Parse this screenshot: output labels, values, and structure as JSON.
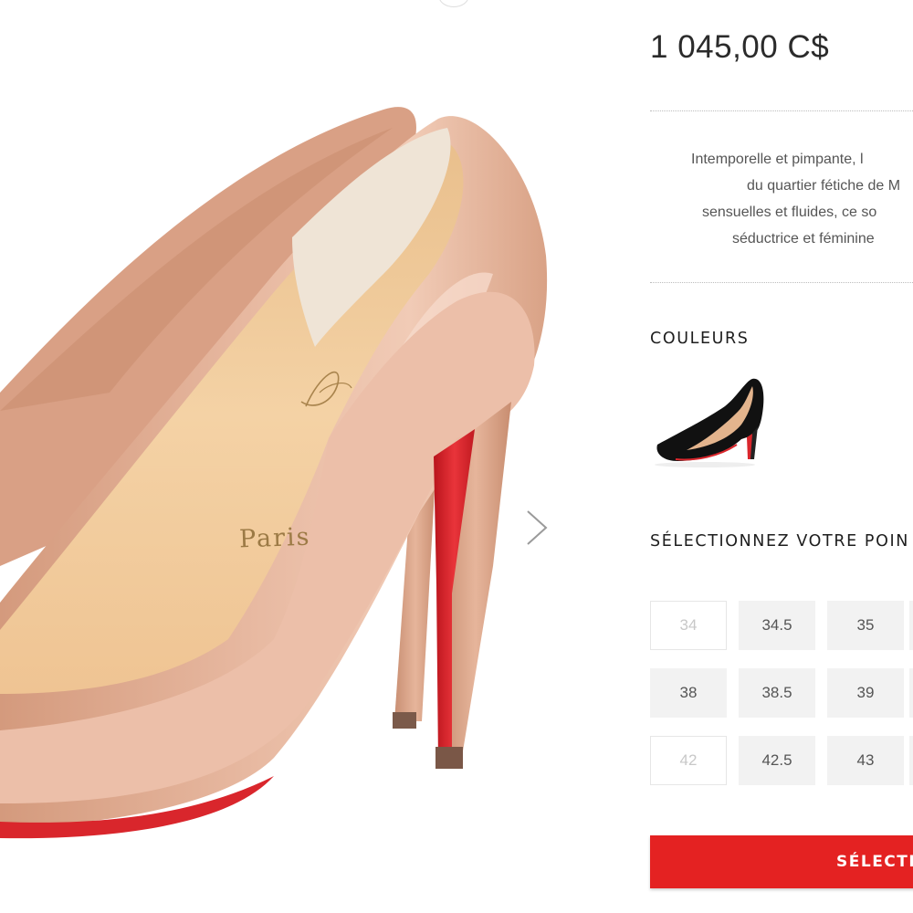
{
  "product": {
    "image_icon": "nude-pump-shoe",
    "insole_text": "Paris",
    "next_icon": "chevron-right-icon",
    "price": "1 045,00 C$",
    "description_lines": [
      "Intemporelle et pimpante, l",
      "du quartier fétiche de M",
      "sensuelles et fluides, ce so",
      "séductrice et féminine"
    ]
  },
  "colors": {
    "title": "COULEURS",
    "swatch_icon": "black-pump-shoe"
  },
  "sizes": {
    "title": "SÉLECTIONNEZ VOTRE POIN",
    "items": [
      {
        "label": "34",
        "available": false
      },
      {
        "label": "34.5",
        "available": true
      },
      {
        "label": "35",
        "available": true
      },
      {
        "label": "38",
        "available": true
      },
      {
        "label": "38.5",
        "available": true
      },
      {
        "label": "39",
        "available": true
      },
      {
        "label": "42",
        "available": false
      },
      {
        "label": "42.5",
        "available": true
      },
      {
        "label": "43",
        "available": true
      }
    ]
  },
  "cta": {
    "label": "SÉLECTI"
  },
  "theme": {
    "accent": "#e42222",
    "sole_red": "#d9262c",
    "nude": "#e3b29a"
  }
}
